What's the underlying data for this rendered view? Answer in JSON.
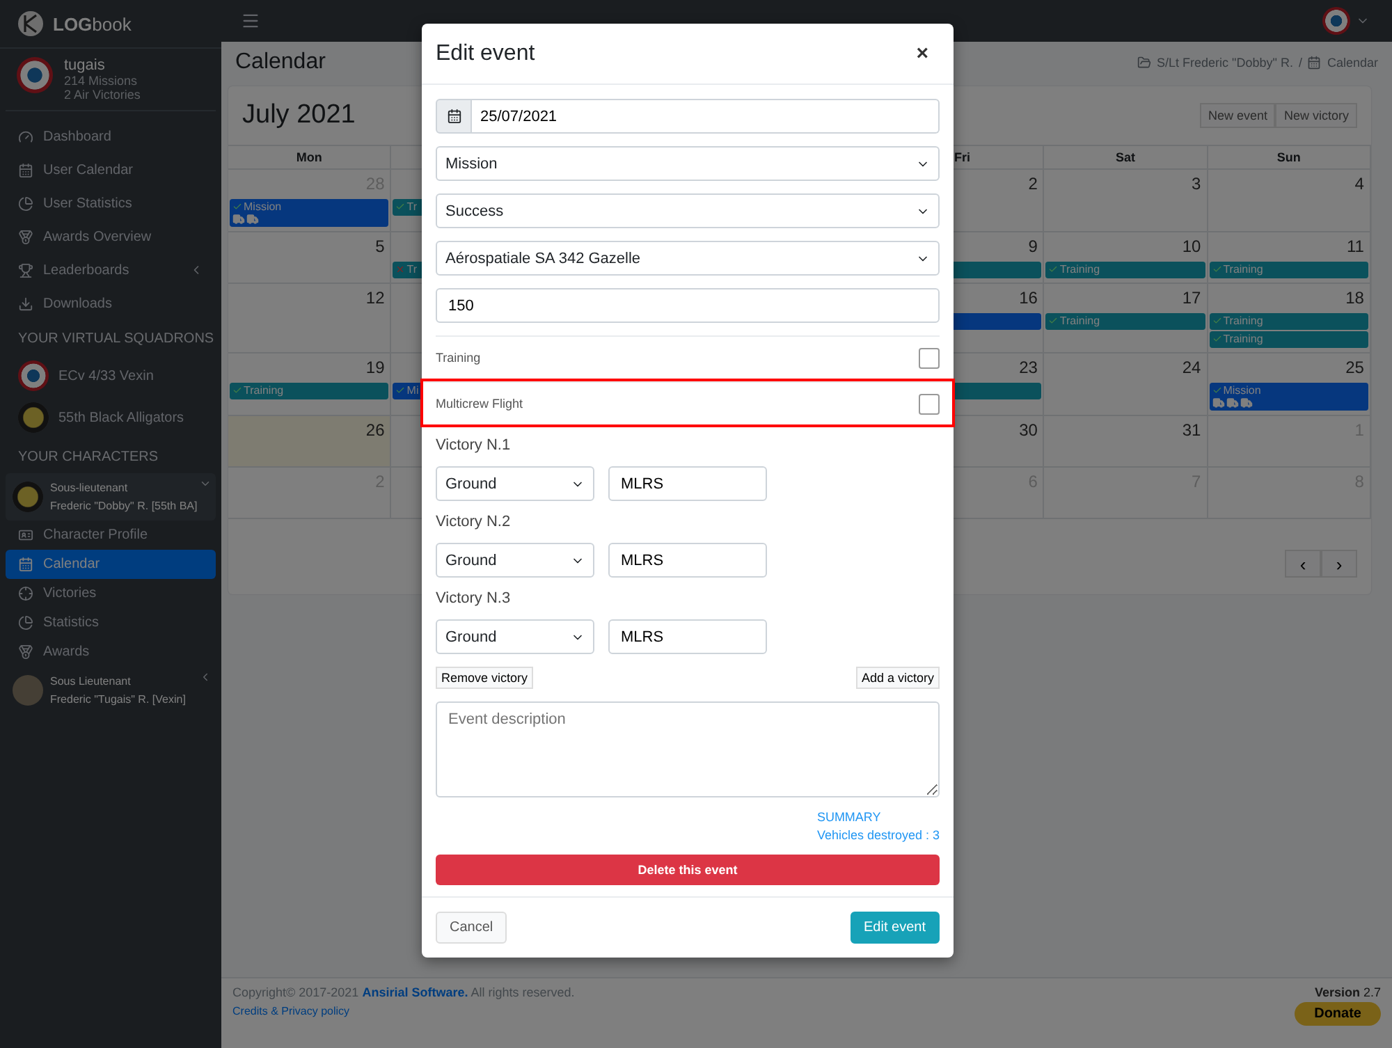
{
  "brand": {
    "logo": "**LOG**book"
  },
  "user": {
    "name": "tugais",
    "missions": "214 Missions",
    "victories": "2 Air Victories"
  },
  "nav": [
    {
      "label": "Dashboard",
      "has_caret": false
    },
    {
      "label": "User Calendar",
      "has_caret": false
    },
    {
      "label": "User Statistics",
      "has_caret": false
    },
    {
      "label": "Awards Overview",
      "has_caret": false
    },
    {
      "label": "Leaderboards",
      "has_caret": true
    },
    {
      "label": "Downloads",
      "has_caret": false
    }
  ],
  "squadrons_heading": "YOUR VIRTUAL SQUADRONS",
  "squadrons": [
    {
      "kind": "roundel",
      "name": "ECv 4/33 Vexin"
    },
    {
      "kind": "badge",
      "name": "55th Black Alligators"
    }
  ],
  "characters_heading": "YOUR CHARACTERS",
  "characters": [
    {
      "kind": "badge",
      "rank": "Sous-lieutenant",
      "name": "Frederic \"Dobby\" R. [55th BA]",
      "expanded": true,
      "items": [
        {
          "label": "Character Profile",
          "selected": false
        },
        {
          "label": "Calendar",
          "selected": true
        },
        {
          "label": "Victories",
          "selected": false
        },
        {
          "label": "Statistics",
          "selected": false
        },
        {
          "label": "Awards",
          "selected": false
        }
      ]
    },
    {
      "kind": "photo",
      "rank": "Sous Lieutenant",
      "name": "Frederic \"Tugais\" R. [Vexin]",
      "expanded": false
    }
  ],
  "page": {
    "title": "Calendar",
    "breadcrumb": [
      "S/Lt Frederic \"Dobby\" R.",
      "Calendar"
    ],
    "breadcrumb_separator": "/"
  },
  "calendar": {
    "month": "July 2021",
    "buttons": [
      "New event",
      "New victory"
    ],
    "weekdays": {
      "mon": "Mon",
      "fri": "Fri",
      "sat": "Sat",
      "sun": "Sun"
    },
    "weeks": [
      {
        "mon": {
          "day": "28",
          "other_month": true,
          "events": [
            {
              "kind": "mission",
              "success": true,
              "label": "Mission",
              "vehicles": [
                {
                  "kind": "truck"
                },
                {
                  "kind": "truck"
                }
              ]
            }
          ]
        },
        "tue": {
          "events": [
            {
              "kind": "training",
              "success": true,
              "label": "Tr"
            }
          ]
        },
        "fri": {
          "day": "2"
        },
        "sat": {
          "day": "3"
        },
        "sun": {
          "day": "4"
        }
      },
      {
        "mon": {
          "day": "5"
        },
        "tue": {
          "events": [
            {
              "kind": "training",
              "success": false,
              "label": "Tr"
            }
          ]
        },
        "fri": {
          "day": "9",
          "events": [
            {
              "kind": "training"
            }
          ]
        },
        "sat": {
          "day": "10",
          "events": [
            {
              "kind": "training",
              "success": true,
              "label": "Training"
            }
          ]
        },
        "sun": {
          "day": "11",
          "events": [
            {
              "kind": "training",
              "success": true,
              "label": "Training"
            }
          ]
        }
      },
      {
        "mon": {
          "day": "12"
        },
        "fri": {
          "day": "16",
          "events": [
            {
              "kind": "mission"
            }
          ]
        },
        "sat": {
          "day": "17",
          "events": [
            {
              "kind": "training",
              "success": true,
              "label": "Training"
            }
          ]
        },
        "sun": {
          "day": "18",
          "events": [
            {
              "kind": "training",
              "success": true,
              "label": "Training"
            },
            {
              "kind": "training",
              "success": true,
              "label": "Training"
            }
          ]
        }
      },
      {
        "mon": {
          "day": "19",
          "events": [
            {
              "kind": "training",
              "success": true,
              "label": "Training"
            }
          ]
        },
        "tue": {
          "events": [
            {
              "kind": "mission",
              "success": true,
              "label": "Mi"
            }
          ]
        },
        "fri": {
          "day": "23",
          "events": [
            {
              "kind": "training"
            }
          ]
        },
        "sat": {
          "day": "24"
        },
        "sun": {
          "day": "25",
          "events": [
            {
              "kind": "mission",
              "success": true,
              "label": "Mission",
              "vehicles": [
                {
                  "kind": "truck"
                },
                {
                  "kind": "truck"
                },
                {
                  "kind": "truck"
                }
              ]
            }
          ]
        }
      },
      {
        "mon": {
          "day": "26",
          "today": true
        },
        "fri": {
          "day": "30"
        },
        "sat": {
          "day": "31"
        },
        "sun": {
          "day": "1",
          "other_month": true
        }
      },
      {
        "mon": {
          "day": "2",
          "other_month": true
        },
        "fri": {
          "day": "6",
          "other_month": true
        },
        "sat": {
          "day": "7",
          "other_month": true
        },
        "sun": {
          "day": "8",
          "other_month": true
        }
      }
    ],
    "pager": [
      "‹",
      "›"
    ]
  },
  "modal": {
    "title": "Edit event",
    "close": "×",
    "date": "25/07/2021",
    "type": "Mission",
    "result": "Success",
    "aircraft": "Aérospatiale SA 342 Gazelle",
    "duration": "150",
    "flags": [
      {
        "label": "Training",
        "checked": false,
        "highlighted": false
      },
      {
        "label": "Multicrew Flight",
        "checked": false,
        "highlighted": true
      }
    ],
    "victories": [
      {
        "label": "Victory N.1",
        "category": "Ground",
        "target": "MLRS"
      },
      {
        "label": "Victory N.2",
        "category": "Ground",
        "target": "MLRS"
      },
      {
        "label": "Victory N.3",
        "category": "Ground",
        "target": "MLRS"
      }
    ],
    "remove_button": "Remove victory",
    "add_button": "Add a victory",
    "description_placeholder": "Event description",
    "summary_title": "SUMMARY",
    "summary_line": "Vehicles destroyed : 3",
    "delete_button": "Delete this event",
    "cancel_button": "Cancel",
    "submit_button": "Edit event"
  },
  "footer": {
    "copyright_before": "Copyright© 2017-2021",
    "company": "Ansirial Software.",
    "copyright_after": "All rights reserved.",
    "credits": "Credits & Privacy policy",
    "version": "**Version** 2.7",
    "donate": "Donate"
  }
}
